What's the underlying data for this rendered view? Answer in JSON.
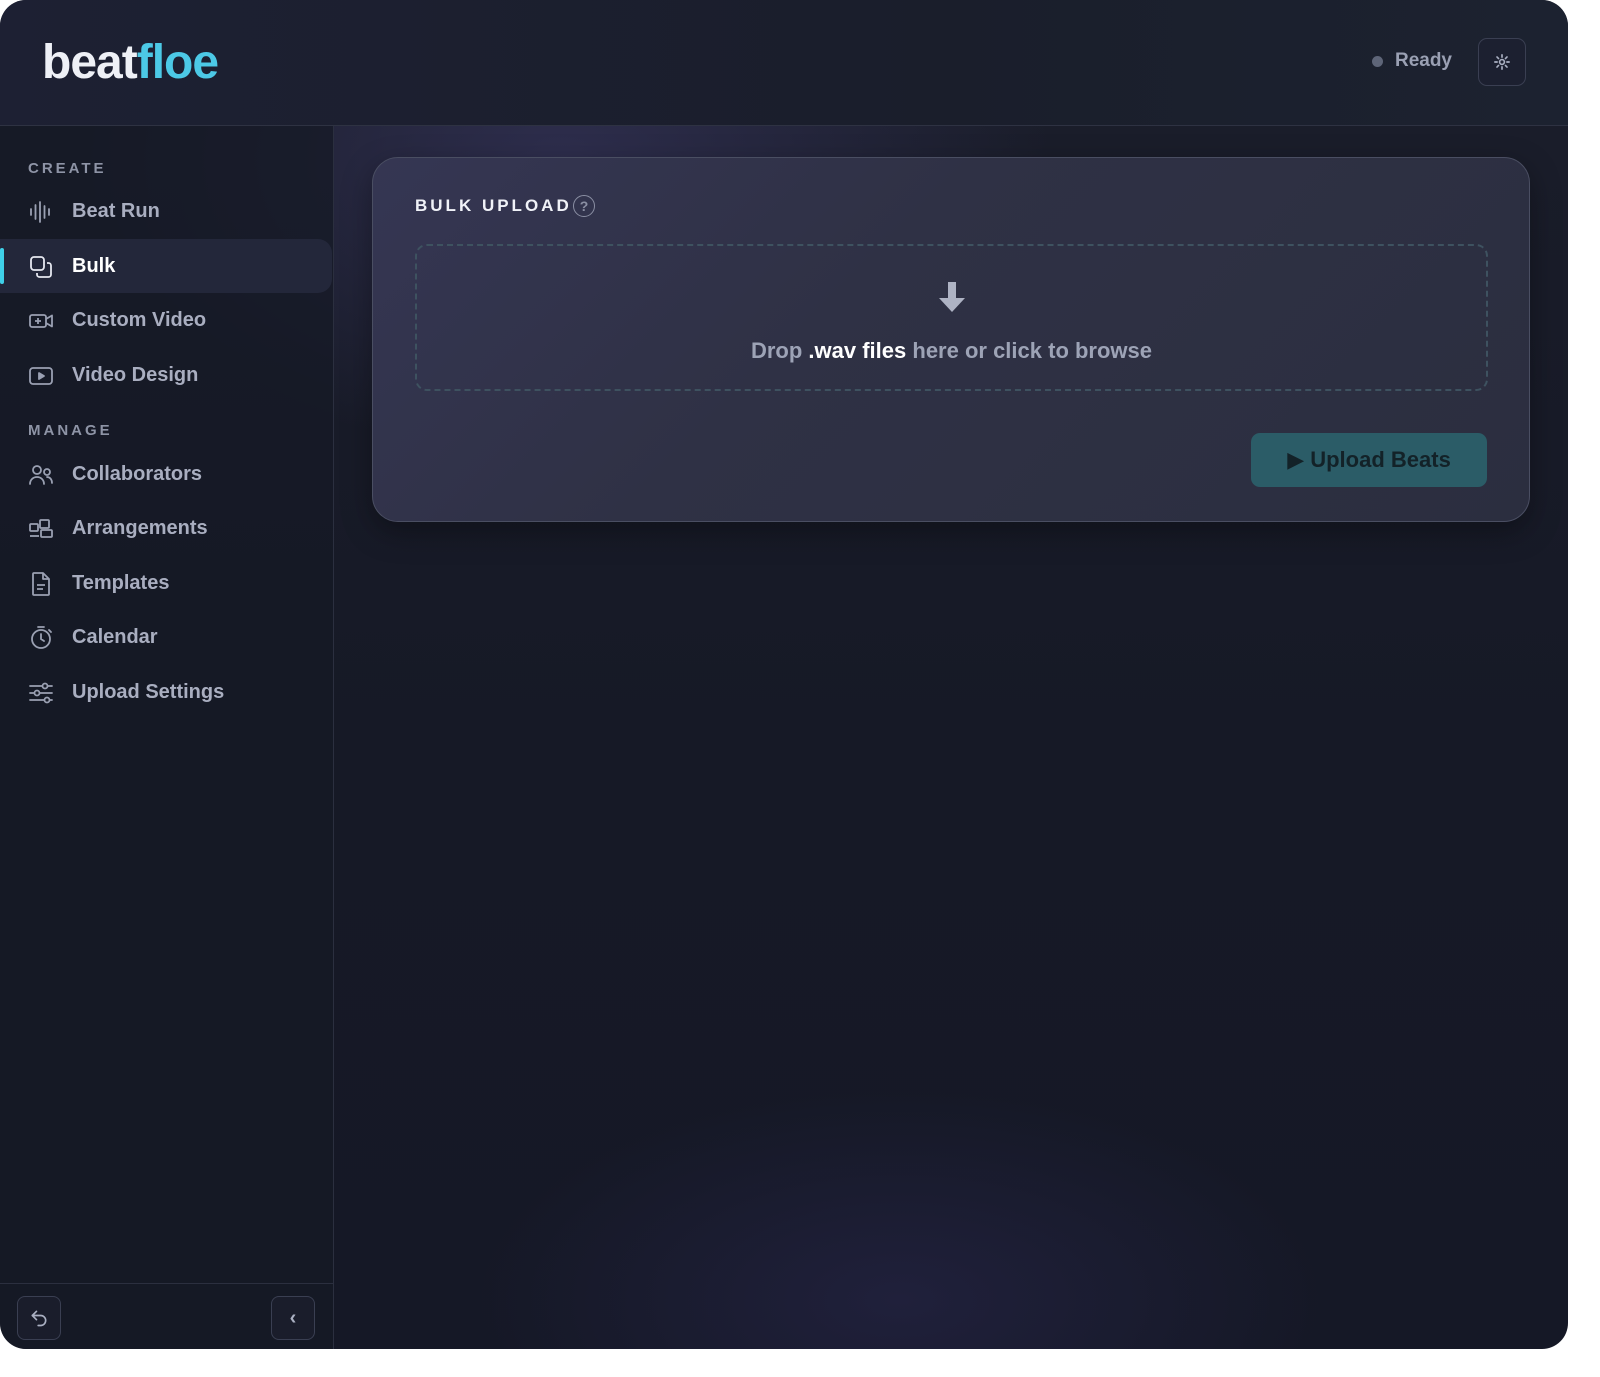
{
  "app": {
    "logo_part1": "beat",
    "logo_part2": "floe",
    "status": "Ready",
    "settings_icon": "gear-icon"
  },
  "sidebar": {
    "sections": [
      {
        "label": "CREATE"
      },
      {
        "label": "MANAGE"
      }
    ],
    "items": [
      {
        "label": "Beat Run",
        "icon": "waveform-icon",
        "active": false
      },
      {
        "label": "Bulk",
        "icon": "stack-icon",
        "active": true
      },
      {
        "label": "Custom Video",
        "icon": "video-camera-icon",
        "active": false
      },
      {
        "label": "Video Design",
        "icon": "play-screen-icon",
        "active": false
      },
      {
        "label": "Collaborators",
        "icon": "users-icon",
        "active": false
      },
      {
        "label": "Arrangements",
        "icon": "blocks-icon",
        "active": false
      },
      {
        "label": "Templates",
        "icon": "document-icon",
        "active": false
      },
      {
        "label": "Calendar",
        "icon": "stopwatch-icon",
        "active": false
      },
      {
        "label": "Upload Settings",
        "icon": "sliders-icon",
        "active": false
      }
    ],
    "footer": {
      "back_icon": "return-icon",
      "collapse_icon": "chevron-left-icon",
      "collapse_glyph": "‹"
    }
  },
  "main": {
    "card_title": "BULK UPLOAD",
    "help_glyph": "?",
    "dropzone": {
      "prefix": "Drop ",
      "emphasis": ".wav files",
      "suffix": " here or click to browse"
    },
    "upload_button": "▶ Upload Beats"
  },
  "colors": {
    "accent": "#4cc9e6",
    "active_bar": "#3fd0e8",
    "button_bg": "#2b5c67",
    "background": "#161926"
  }
}
